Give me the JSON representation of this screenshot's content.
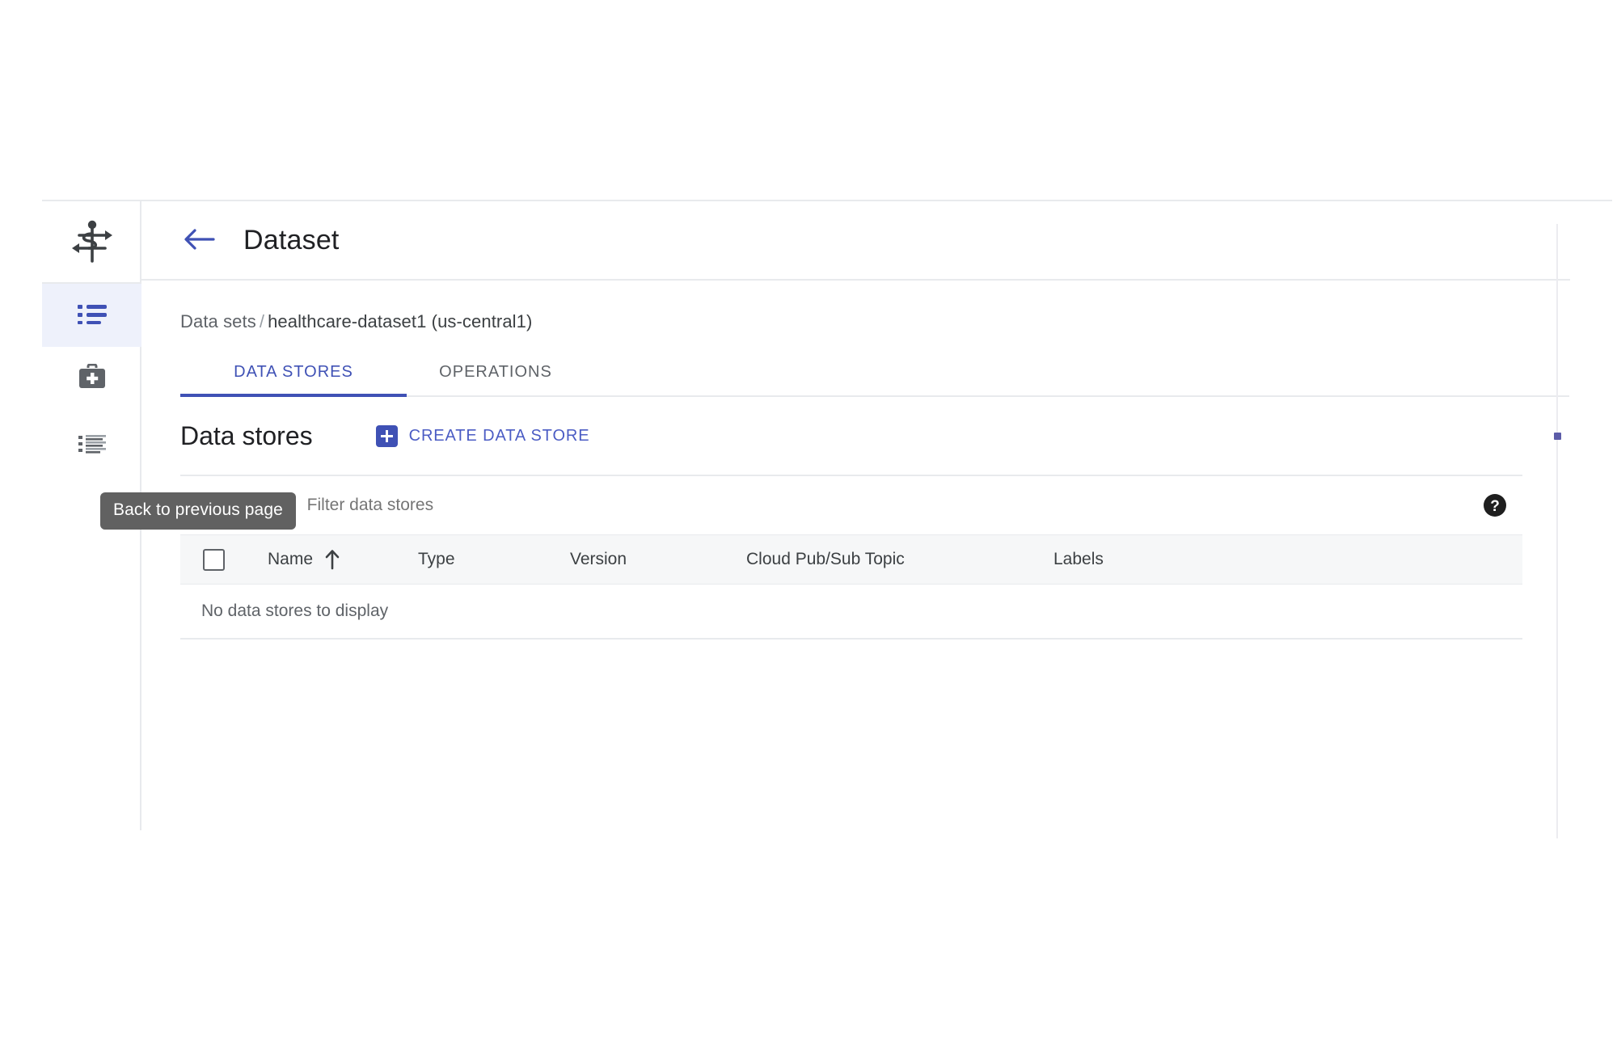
{
  "window": {
    "title": "Dataset"
  },
  "rail": {
    "logo_icon": "caduceus-healthcare-icon",
    "items": [
      {
        "icon": "list-bulleted-icon",
        "name": "datasets",
        "active": true
      },
      {
        "icon": "medical-bag-icon",
        "name": "dicom-stores",
        "active": false
      },
      {
        "icon": "list-detail-icon",
        "name": "operations-log",
        "active": false
      }
    ]
  },
  "topbar": {
    "back_icon": "arrow-left-icon",
    "back_tooltip": "Back to previous page",
    "title": "Dataset"
  },
  "breadcrumb": {
    "root": "Data sets",
    "separator": "/",
    "current": "healthcare-dataset1 (us-central1)"
  },
  "tabs": [
    {
      "label": "DATA STORES",
      "active": true
    },
    {
      "label": "OPERATIONS",
      "active": false
    }
  ],
  "section": {
    "title": "Data stores",
    "create_label": "CREATE DATA STORE",
    "create_icon": "plus-box-icon"
  },
  "filter": {
    "icon": "filter-list-icon",
    "label": "Filter",
    "placeholder": "Filter data stores",
    "value": "",
    "help_icon": "help-circle-icon"
  },
  "table": {
    "columns": [
      {
        "key": "name",
        "label": "Name",
        "sorted": "asc",
        "sort_icon": "arrow-up-icon"
      },
      {
        "key": "type",
        "label": "Type"
      },
      {
        "key": "version",
        "label": "Version"
      },
      {
        "key": "topic",
        "label": "Cloud Pub/Sub Topic"
      },
      {
        "key": "labels",
        "label": "Labels"
      }
    ],
    "rows": [],
    "empty_message": "No data stores to display",
    "select_all_checked": false
  },
  "colors": {
    "accent": "#3f51b5",
    "link": "#4b5cc4",
    "tooltip_bg": "#616161",
    "active_rail_bg": "#eef1fb",
    "border": "#e8eaed",
    "table_header_bg": "#f6f7f8",
    "text_primary": "#202124",
    "text_secondary": "#5f6368"
  }
}
